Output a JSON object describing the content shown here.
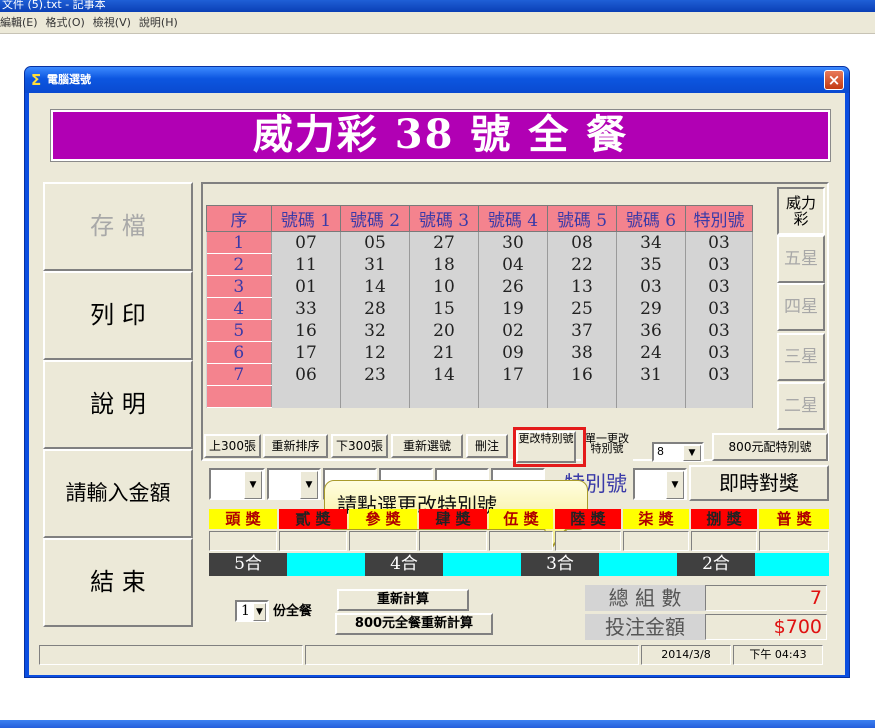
{
  "notepad": {
    "title": "文件 (5).txt - 記事本",
    "menu": [
      "編輯(E)",
      "格式(O)",
      "檢視(V)",
      "說明(H)"
    ]
  },
  "dialog": {
    "title": "電腦選號",
    "close": "×",
    "banner": "威力彩 38 號 全 餐"
  },
  "side_buttons": [
    {
      "label": "存 檔",
      "enabled": false
    },
    {
      "label": "列 印",
      "enabled": true
    },
    {
      "label": "說 明",
      "enabled": true
    },
    {
      "label": "請輸入金額",
      "enabled": true
    },
    {
      "label": "結 束",
      "enabled": true
    }
  ],
  "grid": {
    "headers": [
      "序",
      "號碼 1",
      "號碼 2",
      "號碼 3",
      "號碼 4",
      "號碼 5",
      "號碼 6",
      "特別號"
    ],
    "rows": [
      [
        "1",
        "07",
        "05",
        "27",
        "30",
        "08",
        "34",
        "03"
      ],
      [
        "2",
        "11",
        "31",
        "18",
        "04",
        "22",
        "35",
        "03"
      ],
      [
        "3",
        "01",
        "14",
        "10",
        "26",
        "13",
        "03",
        "03"
      ],
      [
        "4",
        "33",
        "28",
        "15",
        "19",
        "25",
        "29",
        "03"
      ],
      [
        "5",
        "16",
        "32",
        "20",
        "02",
        "37",
        "36",
        "03"
      ],
      [
        "6",
        "17",
        "12",
        "21",
        "09",
        "38",
        "24",
        "03"
      ],
      [
        "7",
        "06",
        "23",
        "14",
        "17",
        "16",
        "31",
        "03"
      ],
      [
        "",
        "",
        "",
        "",
        "",
        "",
        "",
        ""
      ]
    ]
  },
  "game_tabs": [
    "威力彩",
    "五星",
    "四星",
    "三星",
    "二星"
  ],
  "toolbar": {
    "prev300": "上300張",
    "resort": "重新排序",
    "next300": "下300張",
    "reselect": "重新選號",
    "delete": "刪注",
    "change_special": "更改特別號",
    "single_change_special": "單一更改特別號",
    "count_select": "8",
    "special_800": "800元配特別號"
  },
  "check": {
    "special_label": "特別號",
    "instant_check": "即時對獎"
  },
  "prizes": [
    {
      "label": "頭 獎",
      "bg": "#ffff00",
      "fg": "#b00000"
    },
    {
      "label": "貳 獎",
      "bg": "#ff0000",
      "fg": "#222222"
    },
    {
      "label": "參 獎",
      "bg": "#ffff00",
      "fg": "#b00000"
    },
    {
      "label": "肆 獎",
      "bg": "#ff0000",
      "fg": "#222222"
    },
    {
      "label": "伍 獎",
      "bg": "#ffff00",
      "fg": "#b00000"
    },
    {
      "label": "陸 獎",
      "bg": "#ff0000",
      "fg": "#222222"
    },
    {
      "label": "柒 獎",
      "bg": "#ffff00",
      "fg": "#b00000"
    },
    {
      "label": "捌 獎",
      "bg": "#ff0000",
      "fg": "#222222"
    },
    {
      "label": "普 獎",
      "bg": "#ffff00",
      "fg": "#b00000"
    }
  ],
  "hits": [
    "5合",
    "4合",
    "3合",
    "2合"
  ],
  "tooltip": "請點選更改特別號",
  "bottom": {
    "portion_value": "1",
    "portion_label": "份全餐",
    "recalc": "重新計算",
    "recalc800": "800元全餐重新計算",
    "total_groups_label": "總 組 數",
    "total_groups_value": "7",
    "total_amount_label": "投注金額",
    "total_amount_value": "$700"
  },
  "status": {
    "date": "2014/3/8",
    "time": "下午 04:43"
  }
}
